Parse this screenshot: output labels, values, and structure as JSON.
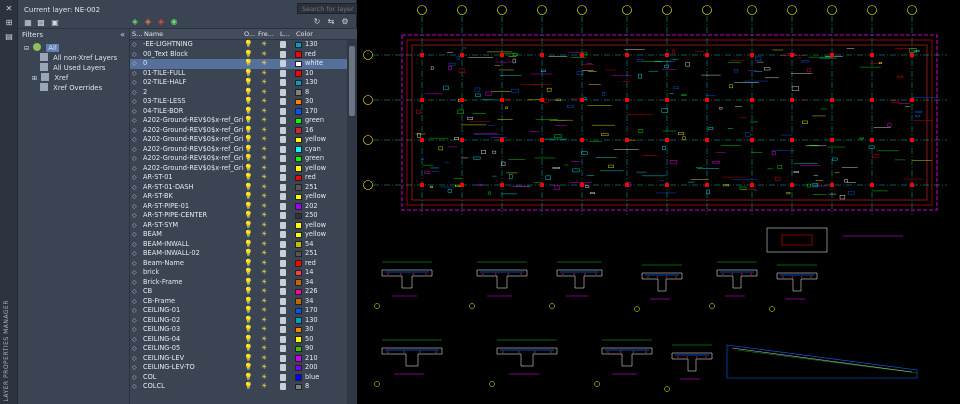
{
  "panel": {
    "rail_title": "LAYER PROPERTIES MANAGER",
    "current_layer": "Current layer: NE-002",
    "search_placeholder": "Search for layer"
  },
  "filters": {
    "title": "Filters",
    "tree": [
      {
        "label": "All",
        "level": 0,
        "selected": true
      },
      {
        "label": "All non-Xref Layers",
        "level": 1,
        "selected": false
      },
      {
        "label": "All Used Layers",
        "level": 1,
        "selected": false
      },
      {
        "label": "Xref",
        "level": 0,
        "selected": false
      },
      {
        "label": "Xref Overrides",
        "level": 1,
        "selected": false
      }
    ]
  },
  "columns": {
    "status": "S...",
    "name": "Name",
    "on": "O...",
    "freeze": "Fre...",
    "lock": "L...",
    "color": "Color"
  },
  "layers": [
    {
      "name": "-EE-LIGHTNING",
      "color": "130",
      "hex": "#00a0c0"
    },
    {
      "name": "00_Text Block",
      "color": "red",
      "hex": "#ff0000"
    },
    {
      "name": "0",
      "color": "white",
      "hex": "#ffffff",
      "selected": true
    },
    {
      "name": "01-TILE-FULL",
      "color": "10",
      "hex": "#ff0000"
    },
    {
      "name": "02-TILE-HALF",
      "color": "130",
      "hex": "#00a0c0"
    },
    {
      "name": "2",
      "color": "8",
      "hex": "#808080"
    },
    {
      "name": "03-TILE-LESS",
      "color": "30",
      "hex": "#ff7f00"
    },
    {
      "name": "04-TILE-BOR",
      "color": "170",
      "hex": "#0055ff"
    },
    {
      "name": "A202-Ground-REV$0$x-ref_Gri...",
      "color": "green",
      "hex": "#00ff00"
    },
    {
      "name": "A202-Ground-REV$0$x-ref_Gri...",
      "color": "16",
      "hex": "#cc2a2a"
    },
    {
      "name": "A202-Ground-REV$0$x-ref_Gri...",
      "color": "yellow",
      "hex": "#ffff00"
    },
    {
      "name": "A202-Ground-REV$0$x-ref_Gri...",
      "color": "cyan",
      "hex": "#00ffff"
    },
    {
      "name": "A202-Ground-REV$0$x-ref_Gri...",
      "color": "green",
      "hex": "#00ff00"
    },
    {
      "name": "A202-Ground-REV$0$x-ref_Gri...",
      "color": "yellow",
      "hex": "#ffff00"
    },
    {
      "name": "AR-ST-01",
      "color": "red",
      "hex": "#ff0000"
    },
    {
      "name": "AR-ST-01-DASH",
      "color": "251",
      "hex": "#555555"
    },
    {
      "name": "AR-ST-BK",
      "color": "yellow",
      "hex": "#ffff00"
    },
    {
      "name": "AR-ST-PIPE-01",
      "color": "202",
      "hex": "#a000ff"
    },
    {
      "name": "AR-ST-PIPE-CENTER",
      "color": "250",
      "hex": "#333333"
    },
    {
      "name": "AR-ST-SYM",
      "color": "yellow",
      "hex": "#ffff00"
    },
    {
      "name": "BEAM",
      "color": "yellow",
      "hex": "#ffff00"
    },
    {
      "name": "BEAM-INWALL",
      "color": "54",
      "hex": "#bfbf00"
    },
    {
      "name": "BEAM-INWALL-02",
      "color": "251",
      "hex": "#555555"
    },
    {
      "name": "Beam-Name",
      "color": "red",
      "hex": "#ff0000"
    },
    {
      "name": "brick",
      "color": "14",
      "hex": "#ff3f3f"
    },
    {
      "name": "Brick-Frame",
      "color": "34",
      "hex": "#bf6a00"
    },
    {
      "name": "CB",
      "color": "226",
      "hex": "#ff00aa"
    },
    {
      "name": "CB-Frame",
      "color": "34",
      "hex": "#bf6a00"
    },
    {
      "name": "CEILING-01",
      "color": "170",
      "hex": "#0055ff"
    },
    {
      "name": "CEILING-02",
      "color": "130",
      "hex": "#00a0c0"
    },
    {
      "name": "CEILING-03",
      "color": "30",
      "hex": "#ff7f00"
    },
    {
      "name": "CEILING-04",
      "color": "50",
      "hex": "#ffff00"
    },
    {
      "name": "CEILING-05",
      "color": "90",
      "hex": "#3fbf00"
    },
    {
      "name": "CEILING-LEV",
      "color": "210",
      "hex": "#cc00ff"
    },
    {
      "name": "CEILING-LEV-TO",
      "color": "200",
      "hex": "#7f00ff"
    },
    {
      "name": "COL",
      "color": "blue",
      "hex": "#0000ff"
    },
    {
      "name": "COLCL",
      "color": "8",
      "hex": "#808080"
    }
  ]
}
